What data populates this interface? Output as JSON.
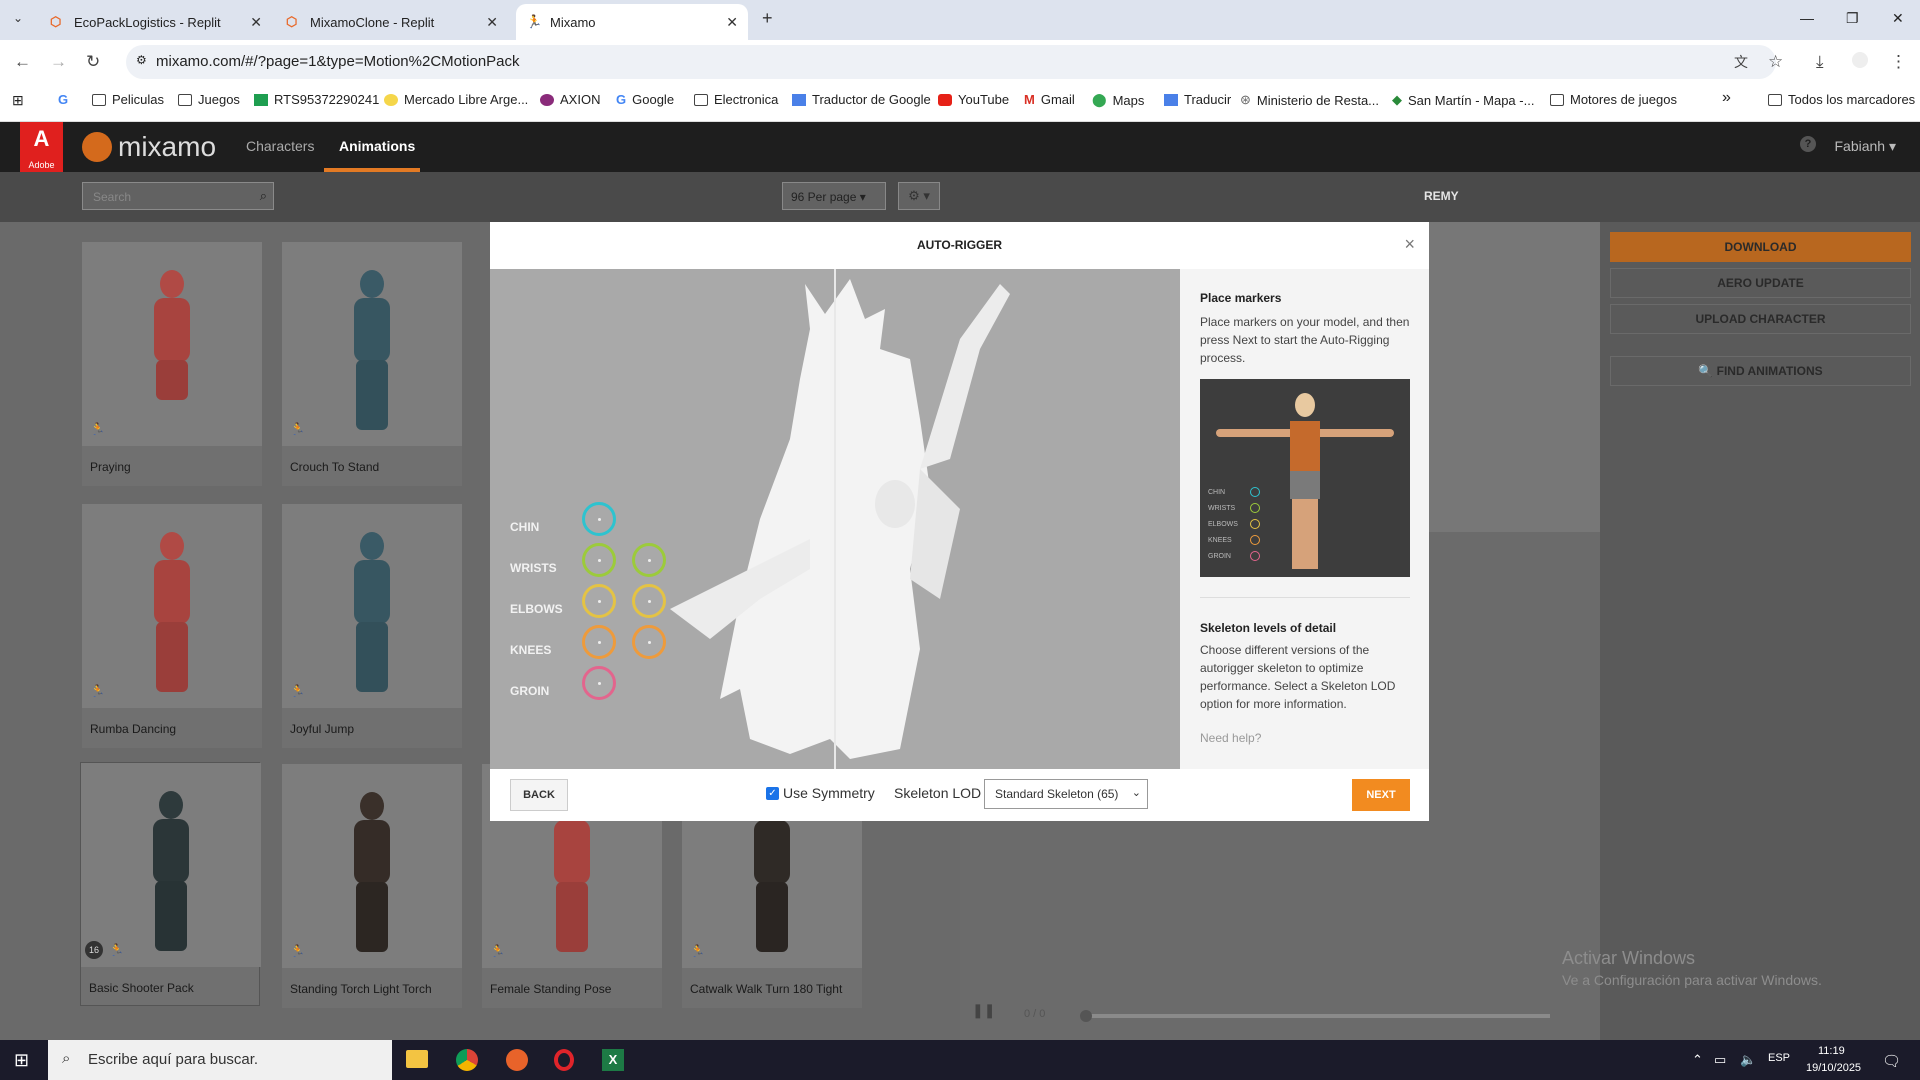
{
  "browser": {
    "tabs": [
      {
        "title": "EcoPackLogistics - Replit"
      },
      {
        "title": "MixamoClone - Replit"
      },
      {
        "title": "Mixamo"
      }
    ],
    "url": "mixamo.com/#/?page=1&type=Motion%2CMotionPack",
    "bookmarks": [
      "Peliculas",
      "Juegos",
      "RTS95372290241",
      "Mercado Libre Arge...",
      "AXION",
      "Google",
      "Electronica",
      "Traductor de Google",
      "YouTube",
      "Gmail",
      "Maps",
      "Traducir",
      "Ministerio de Resta...",
      "San Martín - Mapa -...",
      "Motores de juegos"
    ],
    "all_bookmarks": "Todos los marcadores",
    "more": "»"
  },
  "mixamo": {
    "adobe": "Adobe",
    "logo": "mixamo",
    "nav": [
      "Characters",
      "Animations"
    ],
    "user": "Fabianh ▾",
    "search_placeholder": "Search",
    "per_page": "96 Per page ▾",
    "gear": "⚙ ▾",
    "character": "REMY",
    "right_buttons": [
      "DOWNLOAD",
      "AERO UPDATE",
      "UPLOAD CHARACTER",
      "🔍 FIND ANIMATIONS"
    ],
    "cards": [
      "Praying",
      "Crouch To Stand",
      "Rumba Dancing",
      "Joyful Jump",
      "Basic Shooter Pack",
      "Standing Torch Light Torch",
      "Female Standing Pose",
      "Catwalk Walk Turn 180 Tight"
    ],
    "pack_count": "16",
    "playback": "0 / 0"
  },
  "modal": {
    "title": "AUTO-RIGGER",
    "close": "×",
    "markers": [
      "CHIN",
      "WRISTS",
      "ELBOWS",
      "KNEES",
      "GROIN"
    ],
    "place_title": "Place markers",
    "place_text": "Place markers on your model, and then press Next to start the Auto-Rigging process.",
    "legend": [
      "CHIN",
      "WRISTS",
      "ELBOWS",
      "KNEES",
      "GROIN"
    ],
    "lod_title": "Skeleton levels of detail",
    "lod_text": "Choose different versions of the autorigger skeleton to optimize performance. Select a Skeleton LOD option for more information.",
    "help": "Need help?",
    "back": "BACK",
    "symmetry": "Use Symmetry",
    "lod_label": "Skeleton LOD",
    "lod_value": "Standard Skeleton (65)",
    "next": "NEXT",
    "marker_colors": [
      "#2ec3cf",
      "#9ccb3b",
      "#e4c344",
      "#ee9b3c",
      "#e3658d"
    ]
  },
  "windows": {
    "activate1": "Activar Windows",
    "activate2": "Ve a Configuración para activar Windows.",
    "search": "Escribe aquí para buscar.",
    "lang": "ESP",
    "time": "11:19",
    "date": "19/10/2025"
  }
}
